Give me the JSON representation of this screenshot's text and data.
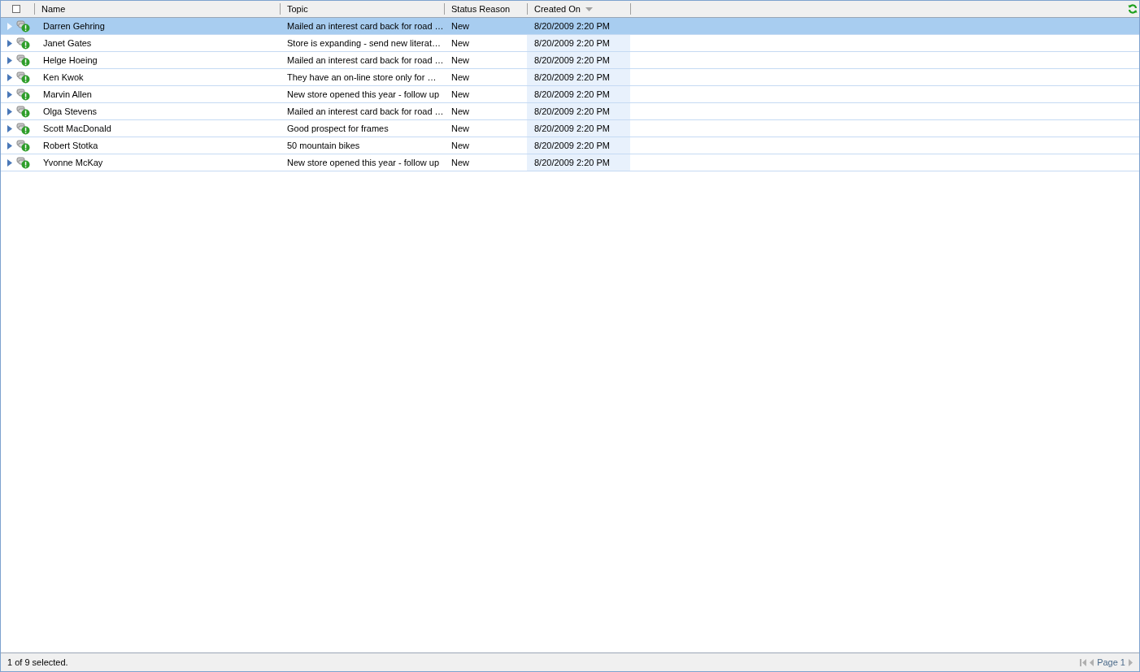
{
  "grid": {
    "select_all": {
      "checked": false
    },
    "columns": [
      {
        "label": "Name",
        "sorted": false
      },
      {
        "label": "Topic",
        "sorted": false
      },
      {
        "label": "Status Reason",
        "sorted": false
      },
      {
        "label": "Created On",
        "sorted": true
      }
    ],
    "rows": [
      {
        "name": "Darren Gehring",
        "topic": "Mailed an interest card back for road …",
        "status": "New",
        "created": "8/20/2009 2:20 PM",
        "selected": true
      },
      {
        "name": "Janet Gates",
        "topic": "Store is expanding - send new literat…",
        "status": "New",
        "created": "8/20/2009 2:20 PM",
        "selected": false
      },
      {
        "name": "Helge Hoeing",
        "topic": "Mailed an interest card back for road …",
        "status": "New",
        "created": "8/20/2009 2:20 PM",
        "selected": false
      },
      {
        "name": "Ken Kwok",
        "topic": "They have an on-line store only for …",
        "status": "New",
        "created": "8/20/2009 2:20 PM",
        "selected": false
      },
      {
        "name": "Marvin Allen",
        "topic": "New store opened this year - follow up",
        "status": "New",
        "created": "8/20/2009 2:20 PM",
        "selected": false
      },
      {
        "name": "Olga Stevens",
        "topic": "Mailed an interest card back for road …",
        "status": "New",
        "created": "8/20/2009 2:20 PM",
        "selected": false
      },
      {
        "name": "Scott MacDonald",
        "topic": "Good prospect for frames",
        "status": "New",
        "created": "8/20/2009 2:20 PM",
        "selected": false
      },
      {
        "name": "Robert Stotka",
        "topic": "50 mountain bikes",
        "status": "New",
        "created": "8/20/2009 2:20 PM",
        "selected": false
      },
      {
        "name": "Yvonne McKay",
        "topic": "New store opened this year - follow up",
        "status": "New",
        "created": "8/20/2009 2:20 PM",
        "selected": false
      }
    ]
  },
  "status_bar": {
    "selection": "1 of 9 selected.",
    "page": "Page 1"
  }
}
